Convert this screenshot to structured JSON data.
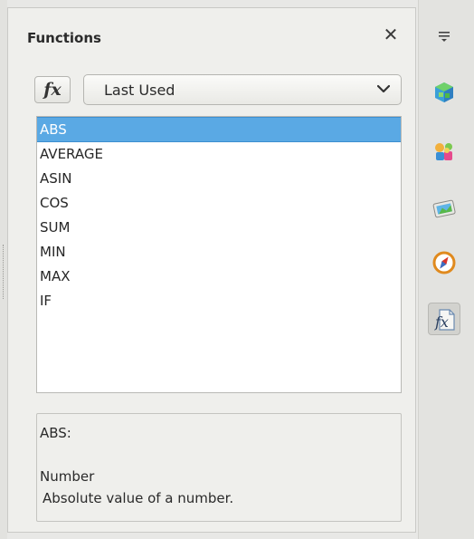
{
  "panel": {
    "title": "Functions",
    "close_glyph": "✕",
    "fx_label": "fx"
  },
  "category_select": {
    "value": "Last Used"
  },
  "functions": [
    "ABS",
    "AVERAGE",
    "ASIN",
    "COS",
    "SUM",
    "MIN",
    "MAX",
    "IF"
  ],
  "selected_index": 0,
  "description": {
    "function_line": "ABS:",
    "argument": "Number",
    "text": "Absolute value of a number."
  },
  "deck": {
    "items": [
      "properties-icon",
      "styles-icon",
      "gallery-icon",
      "navigator-icon",
      "functions-icon"
    ],
    "active": "functions-icon"
  },
  "colors": {
    "selection": "#5aa9e4",
    "panel_bg": "#efefec"
  }
}
